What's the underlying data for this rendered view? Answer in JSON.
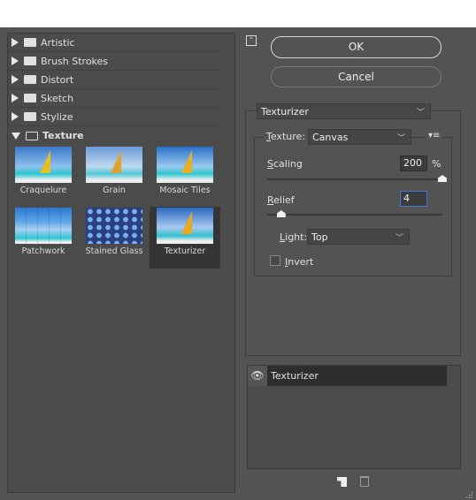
{
  "categories": [
    {
      "label": "Artistic",
      "expanded": false
    },
    {
      "label": "Brush Strokes",
      "expanded": false
    },
    {
      "label": "Distort",
      "expanded": false
    },
    {
      "label": "Sketch",
      "expanded": false
    },
    {
      "label": "Stylize",
      "expanded": false
    },
    {
      "label": "Texture",
      "expanded": true
    }
  ],
  "thumbnails": [
    {
      "label": "Craquelure",
      "selected": false
    },
    {
      "label": "Grain",
      "selected": false
    },
    {
      "label": "Mosaic Tiles",
      "selected": false
    },
    {
      "label": "Patchwork",
      "selected": false
    },
    {
      "label": "Stained Glass",
      "selected": false
    },
    {
      "label": "Texturizer",
      "selected": true
    }
  ],
  "buttons": {
    "ok": "OK",
    "cancel": "Cancel"
  },
  "filter_select": "Texturizer",
  "settings": {
    "texture_label": "Texture:",
    "texture_value": "Canvas",
    "scaling_label": "Scaling",
    "scaling_value": "200",
    "scaling_unit": "%",
    "scaling_percent": 100,
    "relief_label": "Relief",
    "relief_value": "4",
    "relief_fraction": 0.08,
    "light_label": "Light:",
    "light_value": "Top",
    "invert_label": "Invert",
    "invert_checked": false
  },
  "layers": [
    {
      "label": "Texturizer",
      "visible": true
    }
  ],
  "colors": {
    "background": "#535353",
    "focus": "#3b7bd4"
  }
}
